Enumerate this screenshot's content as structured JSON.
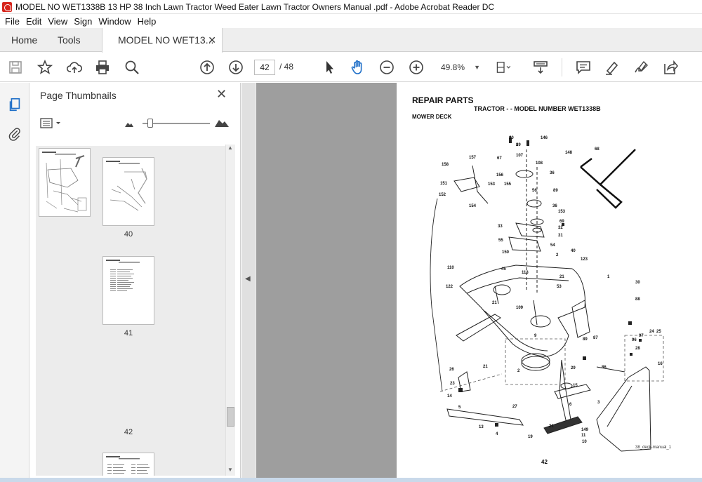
{
  "window": {
    "title": "MODEL NO WET1338B 13 HP 38 Inch Lawn Tractor  Weed Eater Lawn Tractor Owners Manual .pdf - Adobe Acrobat Reader DC"
  },
  "menu": [
    "File",
    "Edit",
    "View",
    "Sign",
    "Window",
    "Help"
  ],
  "tabs": {
    "home": "Home",
    "tools": "Tools",
    "document": "MODEL NO WET13...",
    "close": "✕"
  },
  "toolbar": {
    "page_current": "42",
    "page_total": "/ 48",
    "zoom": "49.8%",
    "icons": [
      "save-icon",
      "star-icon",
      "cloud-upload-icon",
      "print-icon",
      "find-icon",
      "previous-page-icon",
      "next-page-icon",
      "select-cursor-icon",
      "hand-icon",
      "zoom-out-icon",
      "zoom-in-icon",
      "page-fit-icon",
      "scrolling-mode-icon",
      "comment-icon",
      "highlight-icon",
      "sign-icon",
      "share-icon"
    ]
  },
  "sidebar_pane": {
    "title": "Page Thumbnails",
    "close": "✕",
    "thumbnails": [
      {
        "label": "40",
        "selected": false
      },
      {
        "label": "41",
        "selected": false
      },
      {
        "label": "42",
        "selected": true
      }
    ]
  },
  "document": {
    "heading": "REPAIR PARTS",
    "subheading": "TRACTOR - - MODEL NUMBER WET1338B",
    "section": "MOWER DECK",
    "page_number": "42",
    "caption": "38_deck-manual_1",
    "callouts": [
      "40",
      "89",
      "146",
      "148",
      "68",
      "107",
      "108",
      "67",
      "158",
      "157",
      "36",
      "156",
      "153",
      "155",
      "151",
      "89",
      "56",
      "152",
      "36",
      "154",
      "153",
      "69",
      "33",
      "32",
      "55",
      "31",
      "54",
      "40",
      "150",
      "2",
      "45",
      "123",
      "110",
      "113",
      "21",
      "122",
      "53",
      "1",
      "30",
      "21",
      "88",
      "109",
      "87",
      "89",
      "96",
      "97",
      "24",
      "25",
      "28",
      "26",
      "21",
      "2",
      "86",
      "16",
      "29",
      "23",
      "15",
      "3",
      "14",
      "5",
      "6",
      "27",
      "13",
      "4",
      "19",
      "21",
      "149",
      "11",
      "10",
      "9",
      "8",
      "2"
    ]
  }
}
